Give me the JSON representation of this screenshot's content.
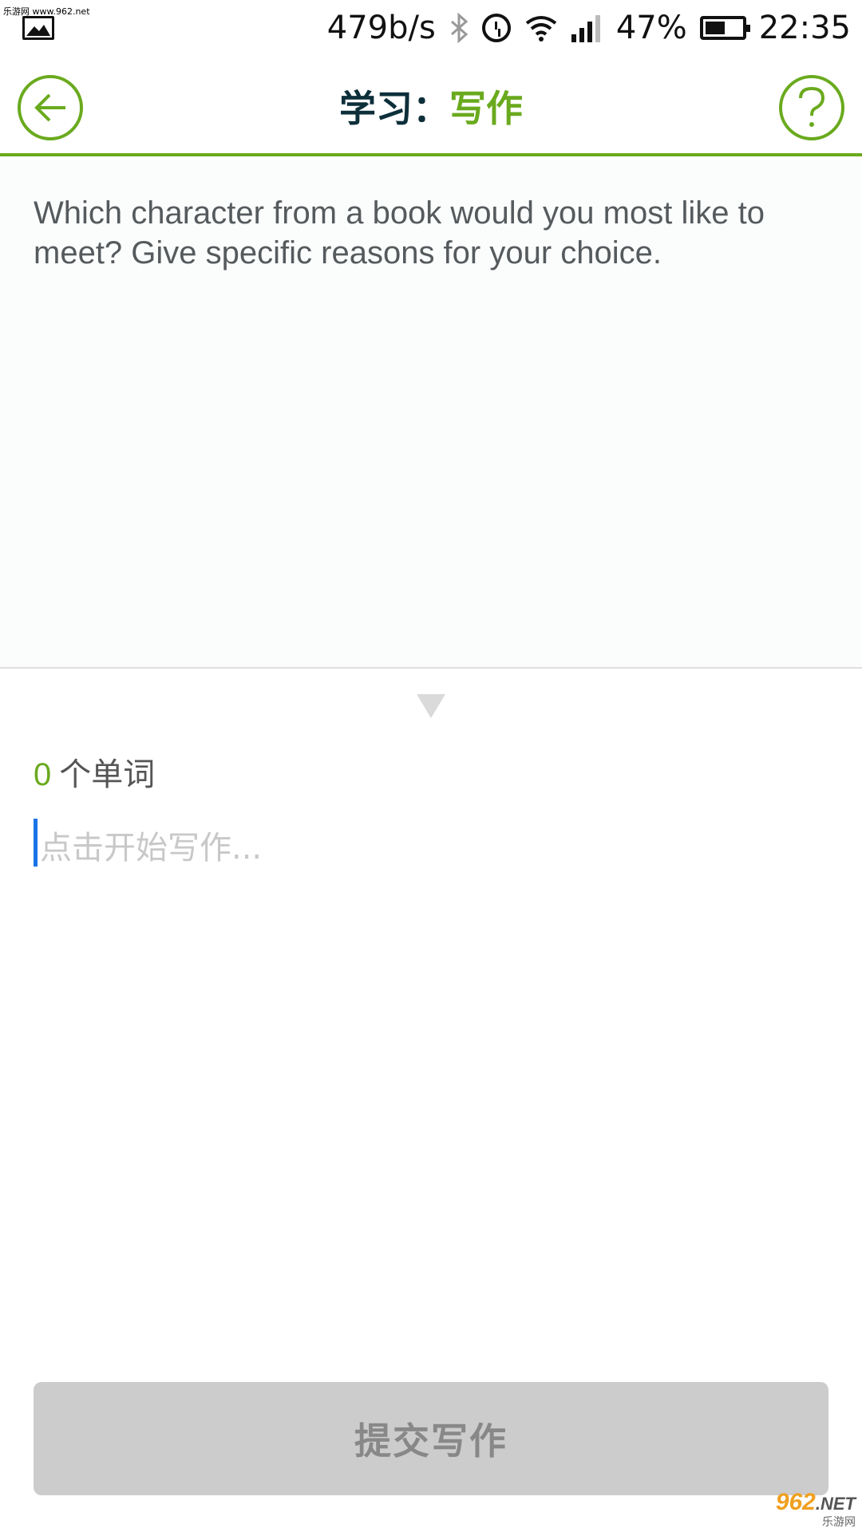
{
  "status_bar": {
    "watermark": "乐游网 www.962.net",
    "net_speed": "479b/s",
    "battery_percent": "47%",
    "time": "22:35",
    "icons": [
      "image-icon",
      "bluetooth-icon",
      "alarm-icon",
      "wifi-icon",
      "signal-icon",
      "battery-icon"
    ]
  },
  "header": {
    "title_prefix": "学习：",
    "title_section": "写作",
    "back_icon": "back-arrow-icon",
    "help_icon": "help-icon",
    "accent_color": "#6aaa1e"
  },
  "prompt": {
    "text": "Which character from a book would you most like to meet? Give specific reasons for your choice."
  },
  "editor": {
    "word_count": "0",
    "word_count_label": "个单词",
    "placeholder": "点击开始写作..."
  },
  "submit": {
    "label": "提交写作"
  },
  "watermark_bottom": {
    "logo": "962",
    "suffix": ".NET",
    "sub": "乐游网"
  }
}
